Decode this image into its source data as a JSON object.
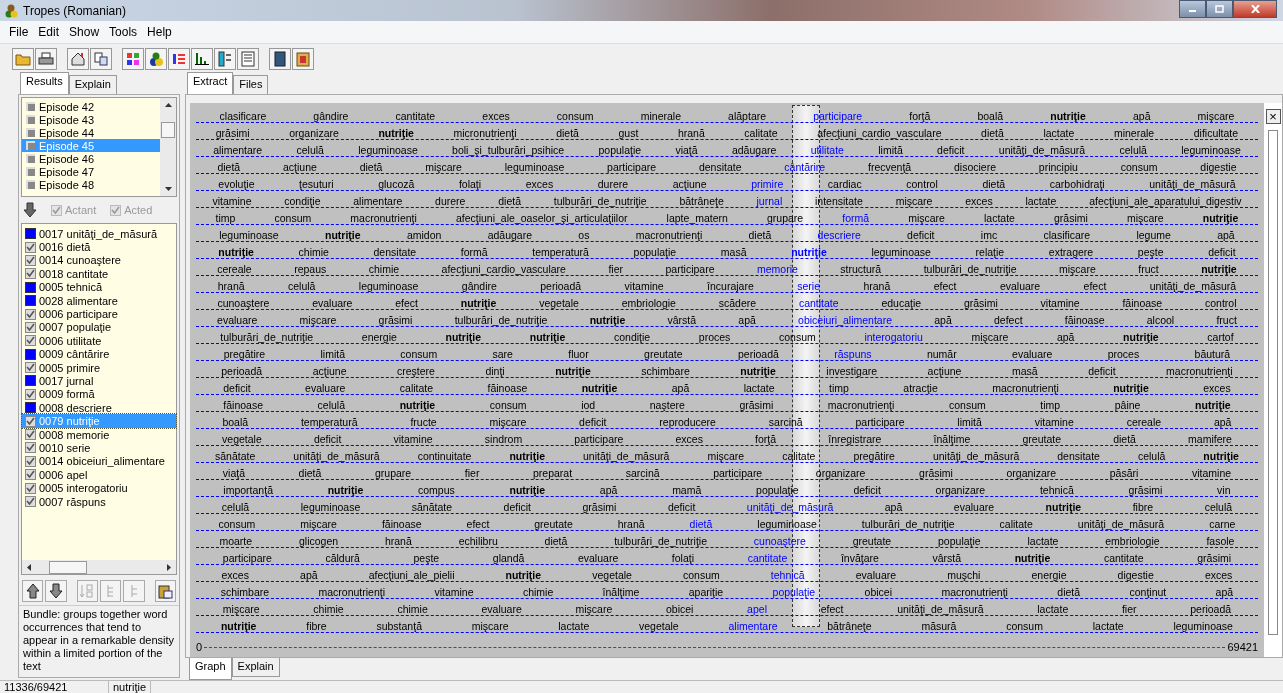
{
  "window": {
    "title": "Tropes (Romanian)"
  },
  "menu": [
    "File",
    "Edit",
    "Show",
    "Tools",
    "Help"
  ],
  "left_tabs": [
    {
      "label": "Results",
      "selected": true
    },
    {
      "label": "Explain",
      "selected": false
    }
  ],
  "episodes": [
    {
      "label": "Episode 42",
      "selected": false
    },
    {
      "label": "Episode 43",
      "selected": false
    },
    {
      "label": "Episode 44",
      "selected": false
    },
    {
      "label": "Episode 45",
      "selected": true
    },
    {
      "label": "Episode 46",
      "selected": false
    },
    {
      "label": "Episode 47",
      "selected": false
    },
    {
      "label": "Episode 48",
      "selected": false
    }
  ],
  "filters": [
    {
      "label": "Actant",
      "checked": true,
      "disabled": true
    },
    {
      "label": "Acted",
      "checked": true,
      "disabled": true
    }
  ],
  "word_list": [
    {
      "label": "0017 unităţi_de_măsură",
      "kind": "swatch",
      "selected": false
    },
    {
      "label": "0016 dietă",
      "kind": "check",
      "selected": false
    },
    {
      "label": "0014 cunoaştere",
      "kind": "check",
      "selected": false
    },
    {
      "label": "0018 cantitate",
      "kind": "check",
      "selected": false
    },
    {
      "label": "0005 tehnică",
      "kind": "swatch",
      "selected": false
    },
    {
      "label": "0028 alimentare",
      "kind": "swatch",
      "selected": false
    },
    {
      "label": "0006 participare",
      "kind": "check",
      "selected": false
    },
    {
      "label": "0007 populaţie",
      "kind": "check",
      "selected": false
    },
    {
      "label": "0006 utilitate",
      "kind": "check",
      "selected": false
    },
    {
      "label": "0009 cântărire",
      "kind": "swatch",
      "selected": false
    },
    {
      "label": "0005 primire",
      "kind": "check",
      "selected": false
    },
    {
      "label": "0017 jurnal",
      "kind": "swatch",
      "selected": false
    },
    {
      "label": "0009 formă",
      "kind": "check",
      "selected": false
    },
    {
      "label": "0008 descriere",
      "kind": "swatch",
      "selected": false
    },
    {
      "label": "0079 nutriţie",
      "kind": "check",
      "selected": true
    },
    {
      "label": "0008 memorie",
      "kind": "check",
      "selected": false
    },
    {
      "label": "0010 serie",
      "kind": "check",
      "selected": false
    },
    {
      "label": "0014 obiceiuri_alimentare",
      "kind": "check",
      "selected": false
    },
    {
      "label": "0006 apel",
      "kind": "check",
      "selected": false
    },
    {
      "label": "0005 interogatoriu",
      "kind": "check",
      "selected": false
    },
    {
      "label": "0007 răspuns",
      "kind": "check",
      "selected": false
    }
  ],
  "description": "Bundle: groups together word occurrences that tend to appear in a remarkable density within a limited portion of the text",
  "right_tabs": [
    {
      "label": "Extract",
      "selected": true
    },
    {
      "label": "Files",
      "selected": false
    }
  ],
  "graph": {
    "close": "×",
    "axis_start": "0",
    "axis_end": "69421",
    "rows": [
      {
        "words": [
          {
            "text": "clasificare",
            "kind": "plain"
          },
          {
            "text": "gândire",
            "kind": "plain"
          },
          {
            "text": "cantitate",
            "kind": "plain"
          },
          {
            "text": "exces",
            "kind": "plain"
          },
          {
            "text": "consum",
            "kind": "plain"
          },
          {
            "text": "minerale",
            "kind": "plain"
          },
          {
            "text": "alăptare",
            "kind": "plain"
          },
          {
            "text": "participare",
            "kind": "linked"
          },
          {
            "text": "forţă",
            "kind": "plain"
          },
          {
            "text": "boală",
            "kind": "plain"
          },
          {
            "text": "nutriţie",
            "kind": "bold"
          },
          {
            "text": "apă",
            "kind": "plain"
          },
          {
            "text": "mişcare",
            "kind": "plain"
          }
        ]
      },
      {
        "words": [
          {
            "text": "grăsimi",
            "kind": "plain"
          },
          {
            "text": "organizare",
            "kind": "plain"
          },
          {
            "text": "nutriţie",
            "kind": "bold"
          },
          {
            "text": "micronutrienţi",
            "kind": "plain"
          },
          {
            "text": "dietă",
            "kind": "plain"
          },
          {
            "text": "gust",
            "kind": "plain"
          },
          {
            "text": "hrană",
            "kind": "plain"
          },
          {
            "text": "calitate",
            "kind": "plain"
          },
          {
            "text": "afecţiuni_cardio_vasculare",
            "kind": "plain"
          },
          {
            "text": "dietă",
            "kind": "plain"
          },
          {
            "text": "lactate",
            "kind": "plain"
          },
          {
            "text": "minerale",
            "kind": "plain"
          },
          {
            "text": "dificultate",
            "kind": "plain"
          }
        ]
      },
      {
        "words": [
          {
            "text": "alimentare",
            "kind": "plain"
          },
          {
            "text": "celulă",
            "kind": "plain"
          },
          {
            "text": "leguminoase",
            "kind": "plain"
          },
          {
            "text": "boli_şi_tulburări_psihice",
            "kind": "plain"
          },
          {
            "text": "populaţie",
            "kind": "plain"
          },
          {
            "text": "viaţă",
            "kind": "plain"
          },
          {
            "text": "adăugare",
            "kind": "plain"
          },
          {
            "text": "utilitate",
            "kind": "linked"
          },
          {
            "text": "limită",
            "kind": "plain"
          },
          {
            "text": "deficit",
            "kind": "plain"
          },
          {
            "text": "unităţi_de_măsură",
            "kind": "plain"
          },
          {
            "text": "celulă",
            "kind": "plain"
          },
          {
            "text": "leguminoase",
            "kind": "plain"
          }
        ]
      },
      {
        "words": [
          {
            "text": "dietă",
            "kind": "plain"
          },
          {
            "text": "acţiune",
            "kind": "plain"
          },
          {
            "text": "dietă",
            "kind": "plain"
          },
          {
            "text": "mişcare",
            "kind": "plain"
          },
          {
            "text": "leguminoase",
            "kind": "plain"
          },
          {
            "text": "participare",
            "kind": "plain"
          },
          {
            "text": "densitate",
            "kind": "plain"
          },
          {
            "text": "cântărire",
            "kind": "linked"
          },
          {
            "text": "frecvenţă",
            "kind": "plain"
          },
          {
            "text": "disociere",
            "kind": "plain"
          },
          {
            "text": "principiu",
            "kind": "plain"
          },
          {
            "text": "consum",
            "kind": "plain"
          },
          {
            "text": "digestie",
            "kind": "plain"
          }
        ]
      },
      {
        "words": [
          {
            "text": "evoluţie",
            "kind": "plain"
          },
          {
            "text": "ţesuturi",
            "kind": "plain"
          },
          {
            "text": "glucoză",
            "kind": "plain"
          },
          {
            "text": "folaţi",
            "kind": "plain"
          },
          {
            "text": "exces",
            "kind": "plain"
          },
          {
            "text": "durere",
            "kind": "plain"
          },
          {
            "text": "acţiune",
            "kind": "plain"
          },
          {
            "text": "primire",
            "kind": "linked"
          },
          {
            "text": "cardiac",
            "kind": "plain"
          },
          {
            "text": "control",
            "kind": "plain"
          },
          {
            "text": "dietă",
            "kind": "plain"
          },
          {
            "text": "carbohidraţi",
            "kind": "plain"
          },
          {
            "text": "unităţi_de_măsură",
            "kind": "plain"
          }
        ]
      },
      {
        "words": [
          {
            "text": "vitamine",
            "kind": "plain"
          },
          {
            "text": "condiţie",
            "kind": "plain"
          },
          {
            "text": "alimentare",
            "kind": "plain"
          },
          {
            "text": "durere",
            "kind": "plain"
          },
          {
            "text": "dietă",
            "kind": "plain"
          },
          {
            "text": "tulburări_de_nutriţie",
            "kind": "plain"
          },
          {
            "text": "bătrâneţe",
            "kind": "plain"
          },
          {
            "text": "jurnal",
            "kind": "linked"
          },
          {
            "text": "intensitate",
            "kind": "plain"
          },
          {
            "text": "mişcare",
            "kind": "plain"
          },
          {
            "text": "exces",
            "kind": "plain"
          },
          {
            "text": "lactate",
            "kind": "plain"
          },
          {
            "text": "afecţiuni_ale_aparatului_digestiv",
            "kind": "plain"
          }
        ]
      },
      {
        "words": [
          {
            "text": "timp",
            "kind": "plain"
          },
          {
            "text": "consum",
            "kind": "plain"
          },
          {
            "text": "macronutrienţi",
            "kind": "plain"
          },
          {
            "text": "afecţiuni_ale_oaselor_şi_articulaţiilor",
            "kind": "plain"
          },
          {
            "text": "lapte_matern",
            "kind": "plain"
          },
          {
            "text": "grupare",
            "kind": "plain"
          },
          {
            "text": "formă",
            "kind": "linked"
          },
          {
            "text": "mişcare",
            "kind": "plain"
          },
          {
            "text": "lactate",
            "kind": "plain"
          },
          {
            "text": "grăsimi",
            "kind": "plain"
          },
          {
            "text": "mişcare",
            "kind": "plain"
          },
          {
            "text": "nutriţie",
            "kind": "bold"
          }
        ]
      },
      {
        "words": [
          {
            "text": "leguminoase",
            "kind": "plain"
          },
          {
            "text": "nutriţie",
            "kind": "bold"
          },
          {
            "text": "amidon",
            "kind": "plain"
          },
          {
            "text": "adăugare",
            "kind": "plain"
          },
          {
            "text": "os",
            "kind": "plain"
          },
          {
            "text": "macronutrienţi",
            "kind": "plain"
          },
          {
            "text": "dietă",
            "kind": "plain"
          },
          {
            "text": "descriere",
            "kind": "linked"
          },
          {
            "text": "deficit",
            "kind": "plain"
          },
          {
            "text": "imc",
            "kind": "plain"
          },
          {
            "text": "clasificare",
            "kind": "plain"
          },
          {
            "text": "legume",
            "kind": "plain"
          },
          {
            "text": "apă",
            "kind": "plain"
          }
        ]
      },
      {
        "words": [
          {
            "text": "nutriţie",
            "kind": "bold"
          },
          {
            "text": "chimie",
            "kind": "plain"
          },
          {
            "text": "densitate",
            "kind": "plain"
          },
          {
            "text": "formă",
            "kind": "plain"
          },
          {
            "text": "temperatură",
            "kind": "plain"
          },
          {
            "text": "populaţie",
            "kind": "plain"
          },
          {
            "text": "masă",
            "kind": "plain"
          },
          {
            "text": "nutriţie",
            "kind": "linked-bold"
          },
          {
            "text": "leguminoase",
            "kind": "plain"
          },
          {
            "text": "relaţie",
            "kind": "plain"
          },
          {
            "text": "extragere",
            "kind": "plain"
          },
          {
            "text": "peşte",
            "kind": "plain"
          },
          {
            "text": "deficit",
            "kind": "plain"
          }
        ]
      },
      {
        "words": [
          {
            "text": "cereale",
            "kind": "plain"
          },
          {
            "text": "repaus",
            "kind": "plain"
          },
          {
            "text": "chimie",
            "kind": "plain"
          },
          {
            "text": "afecţiuni_cardio_vasculare",
            "kind": "plain"
          },
          {
            "text": "fier",
            "kind": "plain"
          },
          {
            "text": "participare",
            "kind": "plain"
          },
          {
            "text": "memorie",
            "kind": "linked"
          },
          {
            "text": "structură",
            "kind": "plain"
          },
          {
            "text": "tulburări_de_nutriţie",
            "kind": "plain"
          },
          {
            "text": "mişcare",
            "kind": "plain"
          },
          {
            "text": "fruct",
            "kind": "plain"
          },
          {
            "text": "nutriţie",
            "kind": "bold"
          }
        ]
      },
      {
        "words": [
          {
            "text": "hrană",
            "kind": "plain"
          },
          {
            "text": "celulă",
            "kind": "plain"
          },
          {
            "text": "leguminoase",
            "kind": "plain"
          },
          {
            "text": "gândire",
            "kind": "plain"
          },
          {
            "text": "perioadă",
            "kind": "plain"
          },
          {
            "text": "vitamine",
            "kind": "plain"
          },
          {
            "text": "încurajare",
            "kind": "plain"
          },
          {
            "text": "serie",
            "kind": "linked"
          },
          {
            "text": "hrană",
            "kind": "plain"
          },
          {
            "text": "efect",
            "kind": "plain"
          },
          {
            "text": "evaluare",
            "kind": "plain"
          },
          {
            "text": "efect",
            "kind": "plain"
          },
          {
            "text": "unităţi_de_măsură",
            "kind": "plain"
          }
        ]
      },
      {
        "words": [
          {
            "text": "cunoaştere",
            "kind": "plain"
          },
          {
            "text": "evaluare",
            "kind": "plain"
          },
          {
            "text": "efect",
            "kind": "plain"
          },
          {
            "text": "nutriţie",
            "kind": "bold"
          },
          {
            "text": "vegetale",
            "kind": "plain"
          },
          {
            "text": "embriologie",
            "kind": "plain"
          },
          {
            "text": "scădere",
            "kind": "plain"
          },
          {
            "text": "cantitate",
            "kind": "linked"
          },
          {
            "text": "educaţie",
            "kind": "plain"
          },
          {
            "text": "grăsimi",
            "kind": "plain"
          },
          {
            "text": "vitamine",
            "kind": "plain"
          },
          {
            "text": "făinoase",
            "kind": "plain"
          },
          {
            "text": "control",
            "kind": "plain"
          }
        ]
      },
      {
        "words": [
          {
            "text": "evaluare",
            "kind": "plain"
          },
          {
            "text": "mişcare",
            "kind": "plain"
          },
          {
            "text": "grăsimi",
            "kind": "plain"
          },
          {
            "text": "tulburări_de_nutriţie",
            "kind": "plain"
          },
          {
            "text": "nutriţie",
            "kind": "bold"
          },
          {
            "text": "vârstă",
            "kind": "plain"
          },
          {
            "text": "apă",
            "kind": "plain"
          },
          {
            "text": "obiceiuri_alimentare",
            "kind": "linked"
          },
          {
            "text": "apă",
            "kind": "plain"
          },
          {
            "text": "defect",
            "kind": "plain"
          },
          {
            "text": "făinoase",
            "kind": "plain"
          },
          {
            "text": "alcool",
            "kind": "plain"
          },
          {
            "text": "fruct",
            "kind": "plain"
          }
        ]
      },
      {
        "words": [
          {
            "text": "tulburări_de_nutriţie",
            "kind": "plain"
          },
          {
            "text": "energie",
            "kind": "plain"
          },
          {
            "text": "nutriţie",
            "kind": "bold"
          },
          {
            "text": "nutriţie",
            "kind": "bold"
          },
          {
            "text": "condiţie",
            "kind": "plain"
          },
          {
            "text": "proces",
            "kind": "plain"
          },
          {
            "text": "consum",
            "kind": "plain"
          },
          {
            "text": "interogatoriu",
            "kind": "linked"
          },
          {
            "text": "mişcare",
            "kind": "plain"
          },
          {
            "text": "apă",
            "kind": "plain"
          },
          {
            "text": "nutriţie",
            "kind": "bold"
          },
          {
            "text": "cartof",
            "kind": "plain"
          }
        ]
      },
      {
        "words": [
          {
            "text": "pregătire",
            "kind": "plain"
          },
          {
            "text": "limită",
            "kind": "plain"
          },
          {
            "text": "consum",
            "kind": "plain"
          },
          {
            "text": "sare",
            "kind": "plain"
          },
          {
            "text": "fluor",
            "kind": "plain"
          },
          {
            "text": "greutate",
            "kind": "plain"
          },
          {
            "text": "perioadă",
            "kind": "plain"
          },
          {
            "text": "răspuns",
            "kind": "linked"
          },
          {
            "text": "număr",
            "kind": "plain"
          },
          {
            "text": "evaluare",
            "kind": "plain"
          },
          {
            "text": "proces",
            "kind": "plain"
          },
          {
            "text": "băutură",
            "kind": "plain"
          }
        ]
      },
      {
        "words": [
          {
            "text": "perioadă",
            "kind": "plain"
          },
          {
            "text": "acţiune",
            "kind": "plain"
          },
          {
            "text": "creştere",
            "kind": "plain"
          },
          {
            "text": "dinţi",
            "kind": "plain"
          },
          {
            "text": "nutriţie",
            "kind": "bold"
          },
          {
            "text": "schimbare",
            "kind": "plain"
          },
          {
            "text": "nutriţie",
            "kind": "bold"
          },
          {
            "text": "investigare",
            "kind": "plain"
          },
          {
            "text": "acţiune",
            "kind": "plain"
          },
          {
            "text": "masă",
            "kind": "plain"
          },
          {
            "text": "deficit",
            "kind": "plain"
          },
          {
            "text": "macronutrienţi",
            "kind": "plain"
          }
        ]
      },
      {
        "words": [
          {
            "text": "deficit",
            "kind": "plain"
          },
          {
            "text": "evaluare",
            "kind": "plain"
          },
          {
            "text": "calitate",
            "kind": "plain"
          },
          {
            "text": "făinoase",
            "kind": "plain"
          },
          {
            "text": "nutriţie",
            "kind": "bold"
          },
          {
            "text": "apă",
            "kind": "plain"
          },
          {
            "text": "lactate",
            "kind": "plain"
          },
          {
            "text": "timp",
            "kind": "plain"
          },
          {
            "text": "atracţie",
            "kind": "plain"
          },
          {
            "text": "macronutrienţi",
            "kind": "plain"
          },
          {
            "text": "nutriţie",
            "kind": "bold"
          },
          {
            "text": "exces",
            "kind": "plain"
          }
        ]
      },
      {
        "words": [
          {
            "text": "făinoase",
            "kind": "plain"
          },
          {
            "text": "celulă",
            "kind": "plain"
          },
          {
            "text": "nutriţie",
            "kind": "bold"
          },
          {
            "text": "consum",
            "kind": "plain"
          },
          {
            "text": "iod",
            "kind": "plain"
          },
          {
            "text": "naştere",
            "kind": "plain"
          },
          {
            "text": "grăsimi",
            "kind": "plain"
          },
          {
            "text": "macronutrienţi",
            "kind": "plain"
          },
          {
            "text": "consum",
            "kind": "plain"
          },
          {
            "text": "timp",
            "kind": "plain"
          },
          {
            "text": "pâine",
            "kind": "plain"
          },
          {
            "text": "nutriţie",
            "kind": "bold"
          }
        ]
      },
      {
        "words": [
          {
            "text": "boală",
            "kind": "plain"
          },
          {
            "text": "temperatură",
            "kind": "plain"
          },
          {
            "text": "fructe",
            "kind": "plain"
          },
          {
            "text": "mişcare",
            "kind": "plain"
          },
          {
            "text": "deficit",
            "kind": "plain"
          },
          {
            "text": "reproducere",
            "kind": "plain"
          },
          {
            "text": "sarcină",
            "kind": "plain"
          },
          {
            "text": "participare",
            "kind": "plain"
          },
          {
            "text": "limită",
            "kind": "plain"
          },
          {
            "text": "vitamine",
            "kind": "plain"
          },
          {
            "text": "cereale",
            "kind": "plain"
          },
          {
            "text": "apă",
            "kind": "plain"
          }
        ]
      },
      {
        "words": [
          {
            "text": "vegetale",
            "kind": "plain"
          },
          {
            "text": "deficit",
            "kind": "plain"
          },
          {
            "text": "vitamine",
            "kind": "plain"
          },
          {
            "text": "sindrom",
            "kind": "plain"
          },
          {
            "text": "participare",
            "kind": "plain"
          },
          {
            "text": "exces",
            "kind": "plain"
          },
          {
            "text": "forţă",
            "kind": "plain"
          },
          {
            "text": "înregistrare",
            "kind": "plain"
          },
          {
            "text": "înălţime",
            "kind": "plain"
          },
          {
            "text": "greutate",
            "kind": "plain"
          },
          {
            "text": "dietă",
            "kind": "plain"
          },
          {
            "text": "mamifere",
            "kind": "plain"
          }
        ]
      },
      {
        "words": [
          {
            "text": "sănătate",
            "kind": "plain"
          },
          {
            "text": "unităţi_de_măsură",
            "kind": "plain"
          },
          {
            "text": "continuitate",
            "kind": "plain"
          },
          {
            "text": "nutriţie",
            "kind": "bold"
          },
          {
            "text": "unităţi_de_măsură",
            "kind": "plain"
          },
          {
            "text": "mişcare",
            "kind": "plain"
          },
          {
            "text": "calitate",
            "kind": "plain"
          },
          {
            "text": "pregătire",
            "kind": "plain"
          },
          {
            "text": "unităţi_de_măsură",
            "kind": "plain"
          },
          {
            "text": "densitate",
            "kind": "plain"
          },
          {
            "text": "celulă",
            "kind": "plain"
          },
          {
            "text": "nutriţie",
            "kind": "bold"
          }
        ]
      },
      {
        "words": [
          {
            "text": "viaţă",
            "kind": "plain"
          },
          {
            "text": "dietă",
            "kind": "plain"
          },
          {
            "text": "grupare",
            "kind": "plain"
          },
          {
            "text": "fier",
            "kind": "plain"
          },
          {
            "text": "preparat",
            "kind": "plain"
          },
          {
            "text": "sarcină",
            "kind": "plain"
          },
          {
            "text": "participare",
            "kind": "plain"
          },
          {
            "text": "organizare",
            "kind": "plain"
          },
          {
            "text": "grăsimi",
            "kind": "plain"
          },
          {
            "text": "organizare",
            "kind": "plain"
          },
          {
            "text": "păsări",
            "kind": "plain"
          },
          {
            "text": "vitamine",
            "kind": "plain"
          }
        ]
      },
      {
        "words": [
          {
            "text": "importanţă",
            "kind": "plain"
          },
          {
            "text": "nutriţie",
            "kind": "bold"
          },
          {
            "text": "compus",
            "kind": "plain"
          },
          {
            "text": "nutriţie",
            "kind": "bold"
          },
          {
            "text": "apă",
            "kind": "plain"
          },
          {
            "text": "mamă",
            "kind": "plain"
          },
          {
            "text": "populaţie",
            "kind": "plain"
          },
          {
            "text": "deficit",
            "kind": "plain"
          },
          {
            "text": "organizare",
            "kind": "plain"
          },
          {
            "text": "tehnică",
            "kind": "plain"
          },
          {
            "text": "grăsimi",
            "kind": "plain"
          },
          {
            "text": "vin",
            "kind": "plain"
          }
        ]
      },
      {
        "words": [
          {
            "text": "celulă",
            "kind": "plain"
          },
          {
            "text": "leguminoase",
            "kind": "plain"
          },
          {
            "text": "sănătate",
            "kind": "plain"
          },
          {
            "text": "deficit",
            "kind": "plain"
          },
          {
            "text": "grăsimi",
            "kind": "plain"
          },
          {
            "text": "deficit",
            "kind": "plain"
          },
          {
            "text": "unităţi_de_măsură",
            "kind": "linked"
          },
          {
            "text": "apă",
            "kind": "plain"
          },
          {
            "text": "evaluare",
            "kind": "plain"
          },
          {
            "text": "nutriţie",
            "kind": "bold"
          },
          {
            "text": "fibre",
            "kind": "plain"
          },
          {
            "text": "celulă",
            "kind": "plain"
          }
        ]
      },
      {
        "words": [
          {
            "text": "consum",
            "kind": "plain"
          },
          {
            "text": "mişcare",
            "kind": "plain"
          },
          {
            "text": "făinoase",
            "kind": "plain"
          },
          {
            "text": "efect",
            "kind": "plain"
          },
          {
            "text": "greutate",
            "kind": "plain"
          },
          {
            "text": "hrană",
            "kind": "plain"
          },
          {
            "text": "dietă",
            "kind": "linked"
          },
          {
            "text": "leguminoase",
            "kind": "plain"
          },
          {
            "text": "tulburări_de_nutriţie",
            "kind": "plain"
          },
          {
            "text": "calitate",
            "kind": "plain"
          },
          {
            "text": "unităţi_de_măsură",
            "kind": "plain"
          },
          {
            "text": "carne",
            "kind": "plain"
          }
        ]
      },
      {
        "words": [
          {
            "text": "moarte",
            "kind": "plain"
          },
          {
            "text": "glicogen",
            "kind": "plain"
          },
          {
            "text": "hrană",
            "kind": "plain"
          },
          {
            "text": "echilibru",
            "kind": "plain"
          },
          {
            "text": "dietă",
            "kind": "plain"
          },
          {
            "text": "tulburări_de_nutriţie",
            "kind": "plain"
          },
          {
            "text": "cunoaştere",
            "kind": "linked"
          },
          {
            "text": "greutate",
            "kind": "plain"
          },
          {
            "text": "populaţie",
            "kind": "plain"
          },
          {
            "text": "lactate",
            "kind": "plain"
          },
          {
            "text": "embriologie",
            "kind": "plain"
          },
          {
            "text": "fasole",
            "kind": "plain"
          }
        ]
      },
      {
        "words": [
          {
            "text": "participare",
            "kind": "plain"
          },
          {
            "text": "căldură",
            "kind": "plain"
          },
          {
            "text": "peşte",
            "kind": "plain"
          },
          {
            "text": "glandă",
            "kind": "plain"
          },
          {
            "text": "evaluare",
            "kind": "plain"
          },
          {
            "text": "folaţi",
            "kind": "plain"
          },
          {
            "text": "cantitate",
            "kind": "linked"
          },
          {
            "text": "învăţare",
            "kind": "plain"
          },
          {
            "text": "vârstă",
            "kind": "plain"
          },
          {
            "text": "nutriţie",
            "kind": "bold"
          },
          {
            "text": "cantitate",
            "kind": "plain"
          },
          {
            "text": "grăsimi",
            "kind": "plain"
          }
        ]
      },
      {
        "words": [
          {
            "text": "exces",
            "kind": "plain"
          },
          {
            "text": "apă",
            "kind": "plain"
          },
          {
            "text": "afecţiuni_ale_pielii",
            "kind": "plain"
          },
          {
            "text": "nutriţie",
            "kind": "bold"
          },
          {
            "text": "vegetale",
            "kind": "plain"
          },
          {
            "text": "consum",
            "kind": "plain"
          },
          {
            "text": "tehnică",
            "kind": "linked"
          },
          {
            "text": "evaluare",
            "kind": "plain"
          },
          {
            "text": "muşchi",
            "kind": "plain"
          },
          {
            "text": "energie",
            "kind": "plain"
          },
          {
            "text": "digestie",
            "kind": "plain"
          },
          {
            "text": "exces",
            "kind": "plain"
          }
        ]
      },
      {
        "words": [
          {
            "text": "schimbare",
            "kind": "plain"
          },
          {
            "text": "macronutrienţi",
            "kind": "plain"
          },
          {
            "text": "vitamine",
            "kind": "plain"
          },
          {
            "text": "chimie",
            "kind": "plain"
          },
          {
            "text": "înălţime",
            "kind": "plain"
          },
          {
            "text": "apariţie",
            "kind": "plain"
          },
          {
            "text": "populaţie",
            "kind": "linked"
          },
          {
            "text": "obicei",
            "kind": "plain"
          },
          {
            "text": "macronutrienţi",
            "kind": "plain"
          },
          {
            "text": "dietă",
            "kind": "plain"
          },
          {
            "text": "conţinut",
            "kind": "plain"
          },
          {
            "text": "apă",
            "kind": "plain"
          }
        ]
      },
      {
        "words": [
          {
            "text": "mişcare",
            "kind": "plain"
          },
          {
            "text": "chimie",
            "kind": "plain"
          },
          {
            "text": "chimie",
            "kind": "plain"
          },
          {
            "text": "evaluare",
            "kind": "plain"
          },
          {
            "text": "mişcare",
            "kind": "plain"
          },
          {
            "text": "obicei",
            "kind": "plain"
          },
          {
            "text": "apel",
            "kind": "linked"
          },
          {
            "text": "efect",
            "kind": "plain"
          },
          {
            "text": "unităţi_de_măsură",
            "kind": "plain"
          },
          {
            "text": "lactate",
            "kind": "plain"
          },
          {
            "text": "fier",
            "kind": "plain"
          },
          {
            "text": "perioadă",
            "kind": "plain"
          }
        ]
      },
      {
        "words": [
          {
            "text": "nutriţie",
            "kind": "bold"
          },
          {
            "text": "fibre",
            "kind": "plain"
          },
          {
            "text": "substanţă",
            "kind": "plain"
          },
          {
            "text": "mişcare",
            "kind": "plain"
          },
          {
            "text": "lactate",
            "kind": "plain"
          },
          {
            "text": "vegetale",
            "kind": "plain"
          },
          {
            "text": "alimentare",
            "kind": "linked"
          },
          {
            "text": "bătrâneţe",
            "kind": "plain"
          },
          {
            "text": "măsură",
            "kind": "plain"
          },
          {
            "text": "consum",
            "kind": "plain"
          },
          {
            "text": "lactate",
            "kind": "plain"
          },
          {
            "text": "leguminoase",
            "kind": "plain"
          }
        ]
      }
    ]
  },
  "bottom_tabs": [
    {
      "label": "Graph",
      "selected": true
    },
    {
      "label": "Explain",
      "selected": false
    }
  ],
  "status_bar": [
    "11336/69421",
    "nutriţie"
  ]
}
